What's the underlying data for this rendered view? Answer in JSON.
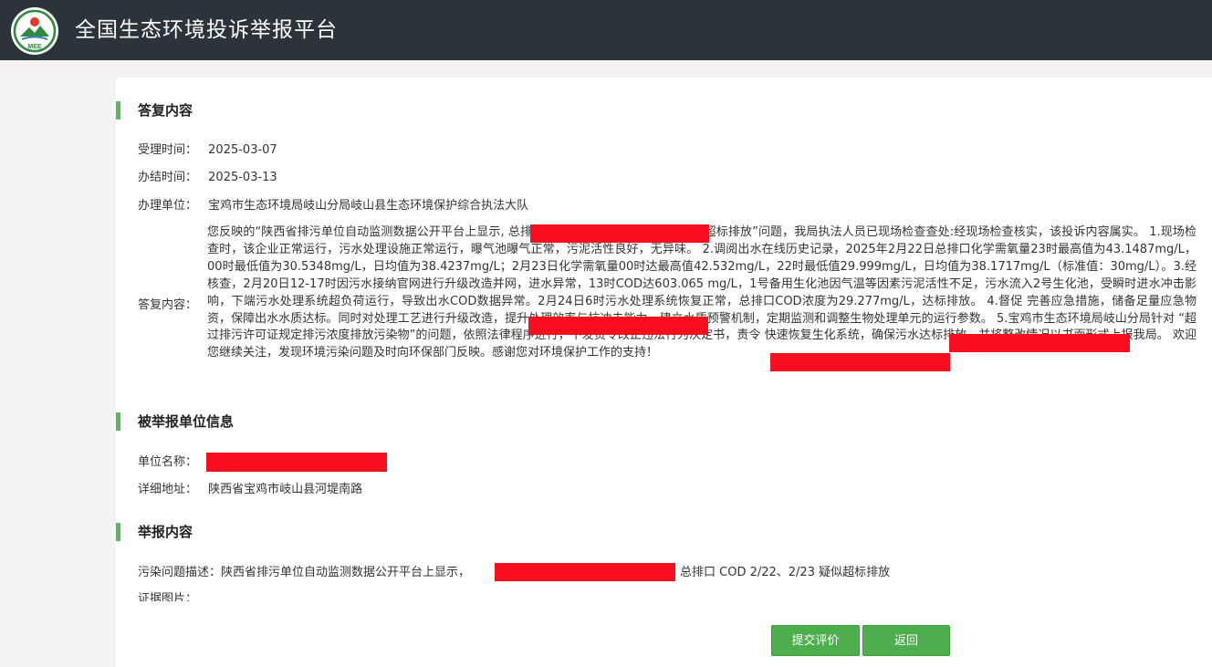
{
  "header": {
    "title": "全国生态环境投诉举报平台",
    "logo_text": "MEE",
    "colors": {
      "bar": "#2b3438",
      "accent": "#5cb85c",
      "redaction": "#f90e1f"
    }
  },
  "reply": {
    "heading": "答复内容",
    "accept_time_label": "受理时间：",
    "accept_time": "2025-03-07",
    "finish_time_label": "办结时间：",
    "finish_time": "2025-03-13",
    "unit_label": "办理单位：",
    "unit": "宝鸡市生态环境局岐山分局岐山县生态环境保护综合执法大队",
    "content_label": "答复内容：",
    "content": "您反映的“陕西省排污单位自动监测数据公开平台上显示,                    总排口COD 2月22日、2月23日疑似超标排放”问题，我局执法人员已现场检查查处:经现场检查核实，该投诉内容属实。 1.现场检查时，该企业正常运行，污水处理设施正常运行，曝气池曝气正常，污泥活性良好，无异味。 2.调阅出水在线历史记录，2025年2月22日总排口化学需氧量23时最高值为43.1487mg/L，00时最低值为30.5348mg/L，日均值为38.4237mg/L；2月23日化学需氧量00时达最高值42.532mg/L，22时最低值29.999mg/L，日均值为38.1717mg/L（标准值：30mg/L）。3.经核查，2月20日12-17时因污水接纳官网进行升级改造并网，进水异常，13时COD达603.065 mg/L，1号备用生化池因气温等因素污泥活性不足，污水流入2号生化池，受瞬时进水冲击影响，下端污水处理系统超负荷运行，导致出水COD数据异常。2月24日6时污水处理系统恢复正常，总排口COD浓度为29.277mg/L，达标排放。 4.督促                    完善应急措施，储备足量应急物资，保障出水水质达标。同时对处理工艺进行升级改造，提升处理效率与抗冲击能力，建立水质预警机制，定期监测和调整生物处理单元的运行参数。 5.宝鸡市生态环境局岐山分局针对                    “超过排污许可证规定排污浓度排放污染物”的问题，依照法律程序进行，下发责令改正违法行为决定书，责令                    快速恢复生化系统，确保污水达标排放，并将整改情况以书面形式上报我局。 欢迎您继续关注，发现环境污染问题及时向环保部门反映。感谢您对环境保护工作的支持！"
  },
  "reported_unit": {
    "heading": "被举报单位信息",
    "name_label": "单位名称：",
    "address_label": "详细地址：",
    "address": "陕西省宝鸡市岐山县河堤南路"
  },
  "report": {
    "heading": "举报内容",
    "desc_label": "污染问题描述：",
    "desc_prefix": "陕西省排污单位自动监测数据公开平台上显示，",
    "desc_suffix": "总排口 COD 2/22、2/23 疑似超标排放",
    "evidence_label": "证据图片："
  },
  "buttons": {
    "submit_label": "提交评价",
    "back_label": "返回"
  }
}
